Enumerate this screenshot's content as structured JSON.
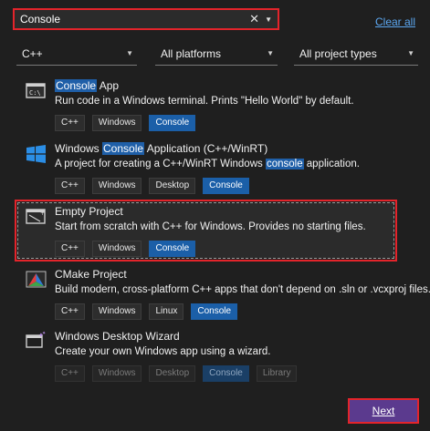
{
  "search": {
    "value": "Console",
    "clear_icon": "close-icon",
    "dropdown_icon": "chevron-down-icon"
  },
  "clear_all_label": "Clear all",
  "filters": {
    "language": "C++",
    "platform": "All platforms",
    "project_type": "All project types"
  },
  "templates": [
    {
      "title": "Console",
      "title_rest": " App",
      "desc": "Run code in a Windows terminal. Prints \"Hello World\" by default.",
      "tags": [
        "C++",
        "Windows",
        "Console"
      ],
      "icon": "console-app-icon"
    },
    {
      "title_pre": "Windows ",
      "title_hl": "Console",
      "title_rest": " Application (C++/WinRT)",
      "desc_pre": "A project for creating a C++/WinRT Windows ",
      "desc_hl": "console",
      "desc_rest": " application.",
      "tags": [
        "C++",
        "Windows",
        "Desktop",
        "Console"
      ],
      "icon": "windows-logo-icon"
    },
    {
      "title": "Empty Project",
      "desc": "Start from scratch with C++ for Windows. Provides no starting files.",
      "tags": [
        "C++",
        "Windows",
        "Console"
      ],
      "icon": "empty-project-icon",
      "selected": true
    },
    {
      "title": "CMake Project",
      "desc": "Build modern, cross-platform C++ apps that don't depend on .sln or .vcxproj files.",
      "tags": [
        "C++",
        "Windows",
        "Linux",
        "Console"
      ],
      "icon": "cmake-icon"
    },
    {
      "title": "Windows Desktop Wizard",
      "desc": "Create your own Windows app using a wizard.",
      "tags": [
        "C++",
        "Windows",
        "Desktop",
        "Console",
        "Library"
      ],
      "icon": "desktop-wizard-icon"
    }
  ],
  "next_label": "Next",
  "colors": {
    "accent": "#1f5fa8",
    "highlight_border": "#e3242b",
    "next_button": "#5b3a8e",
    "link": "#5ca8f2"
  }
}
